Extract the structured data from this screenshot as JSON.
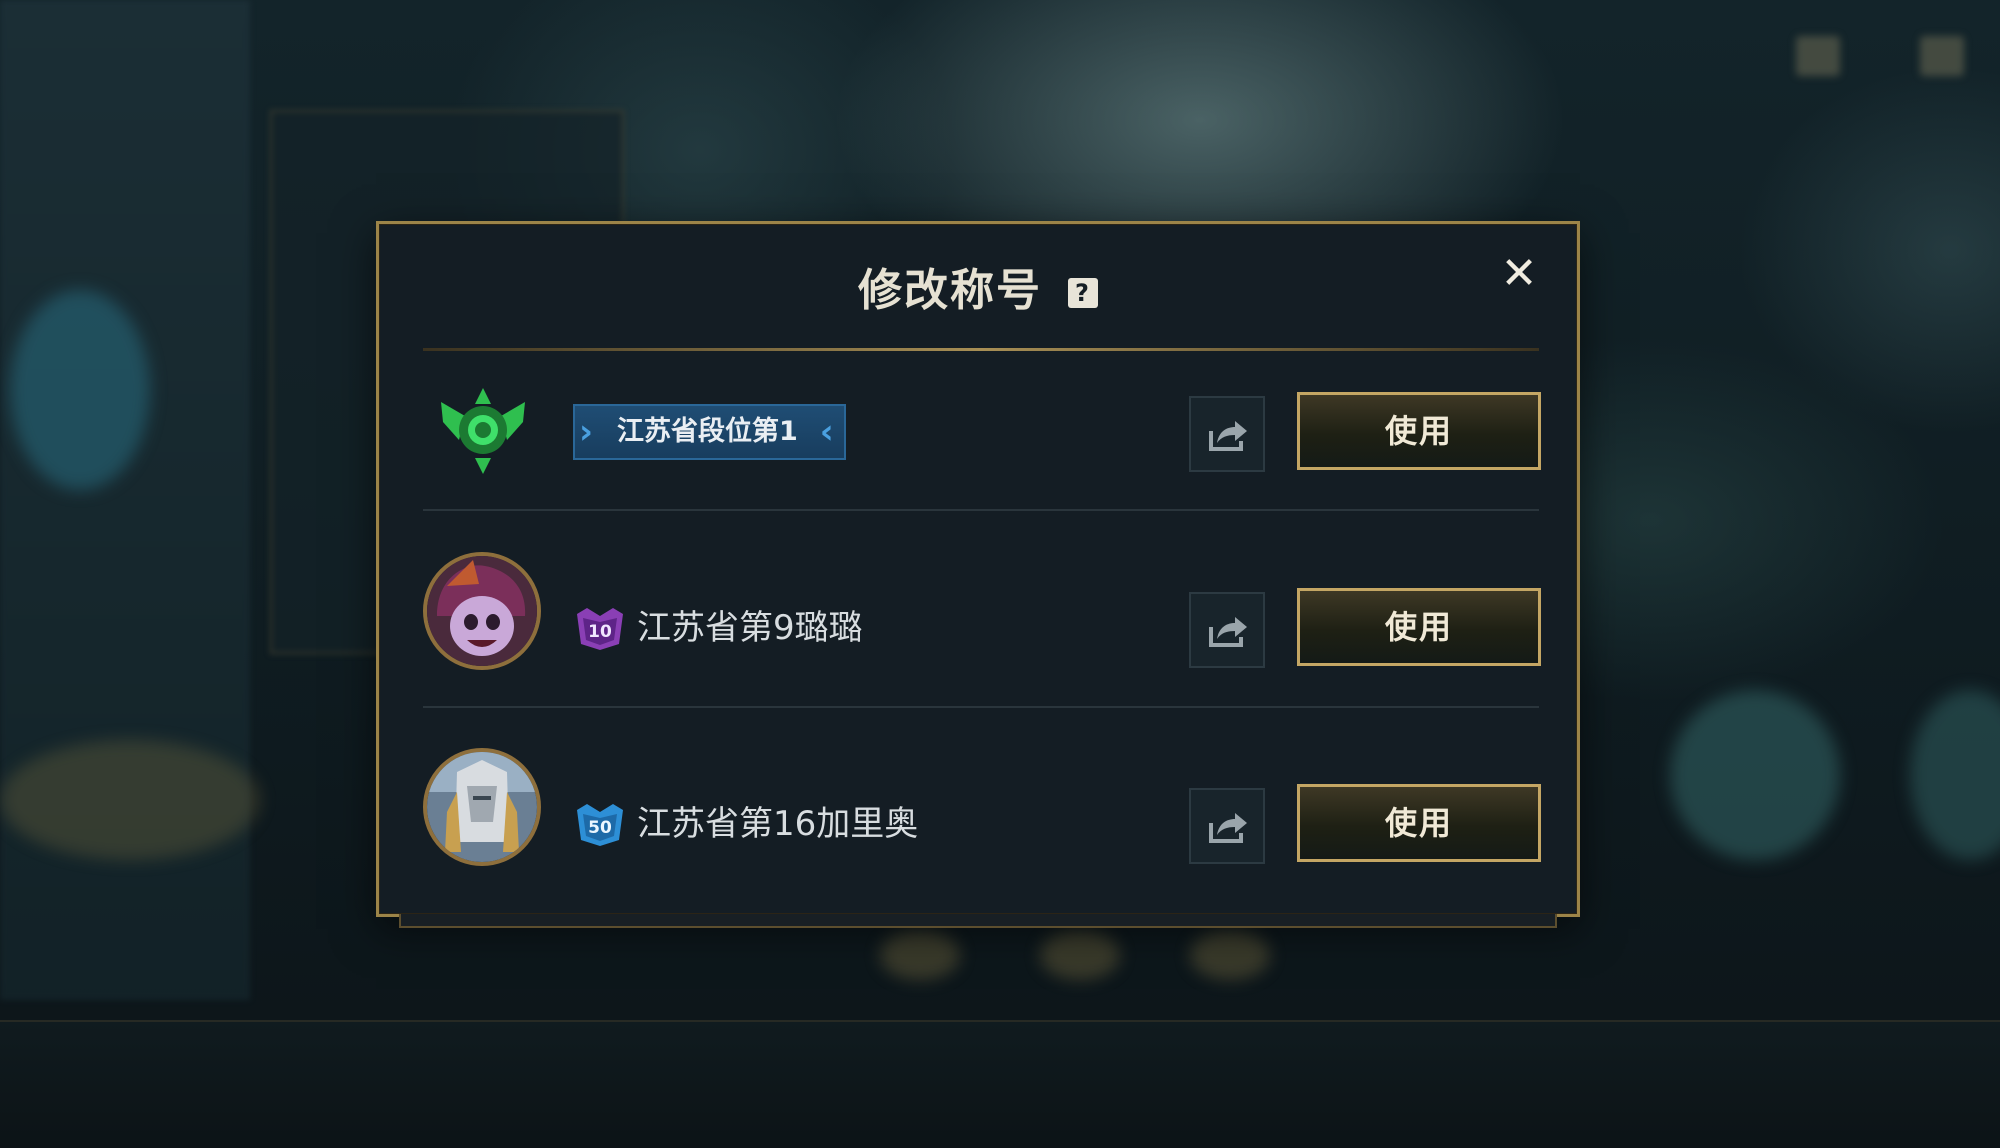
{
  "dialog": {
    "title": "修改称号",
    "help_icon_glyph": "?",
    "close_icon_glyph": "✕"
  },
  "titles": [
    {
      "text": "江苏省段位第1",
      "style": "rank-tag",
      "icon": "green-rank-emblem-icon",
      "use_label": "使用"
    },
    {
      "text": "江苏省第9璐璐",
      "style": "champion",
      "level": "10",
      "level_color": "#8a3fb5",
      "avatar": "lulu-avatar",
      "use_label": "使用"
    },
    {
      "text": "江苏省第16加里奥",
      "style": "champion",
      "level": "50",
      "level_color": "#2d8fd6",
      "avatar": "galio-avatar",
      "use_label": "使用"
    }
  ],
  "colors": {
    "gold_border": "#9c8448",
    "tag_blue": "#1f4d74",
    "emblem_green": "#2fbf4f"
  }
}
